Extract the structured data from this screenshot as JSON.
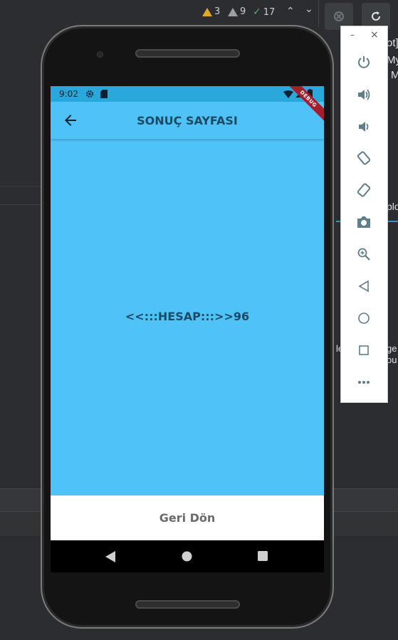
{
  "ide": {
    "warnings_count": "3",
    "weak_warnings_count": "9",
    "typos_count": "17",
    "side_text_1": "ot]",
    "side_text_2": "My",
    "side_text_3": "M",
    "side_text_4": "plo",
    "side_text_5": "ge",
    "side_text_6": "ou",
    "side_text_7": "le"
  },
  "emulator_toolbar": {
    "minimize": "–",
    "close": "×",
    "buttons": [
      {
        "name": "power-icon"
      },
      {
        "name": "volume-up-icon"
      },
      {
        "name": "volume-down-icon"
      },
      {
        "name": "rotate-left-icon"
      },
      {
        "name": "rotate-right-icon"
      },
      {
        "name": "camera-icon"
      },
      {
        "name": "zoom-icon"
      },
      {
        "name": "back-triangle-icon"
      },
      {
        "name": "home-circle-icon"
      },
      {
        "name": "overview-square-icon"
      },
      {
        "name": "more-icon"
      }
    ]
  },
  "device": {
    "status": {
      "time": "9:02"
    },
    "debug_banner": "DEBUG",
    "app_bar": {
      "title": "SONUÇ SAYFASI"
    },
    "body": {
      "result_text": "<<:::HESAP:::>>96"
    },
    "bottom_button": {
      "label": "Geri Dön"
    }
  },
  "colors": {
    "app_bar": "#4fc3f7",
    "status_bar": "#29a8db",
    "text": "#1c4a66",
    "debug_banner": "#a3202a"
  }
}
